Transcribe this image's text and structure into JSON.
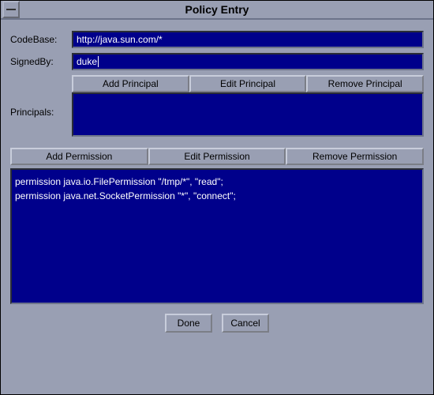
{
  "window": {
    "title": "Policy Entry"
  },
  "fields": {
    "codebase_label": "CodeBase:",
    "codebase_value": "http://java.sun.com/*",
    "signedby_label": "SignedBy:",
    "signedby_value": "duke",
    "principals_label": "Principals:"
  },
  "principal_buttons": {
    "add": "Add Principal",
    "edit": "Edit Principal",
    "remove": "Remove Principal"
  },
  "permission_buttons": {
    "add": "Add Permission",
    "edit": "Edit Permission",
    "remove": "Remove Permission"
  },
  "permissions": [
    "permission java.io.FilePermission \"/tmp/*\", \"read\";",
    "permission java.net.SocketPermission \"*\", \"connect\";"
  ],
  "footer": {
    "done": "Done",
    "cancel": "Cancel"
  }
}
